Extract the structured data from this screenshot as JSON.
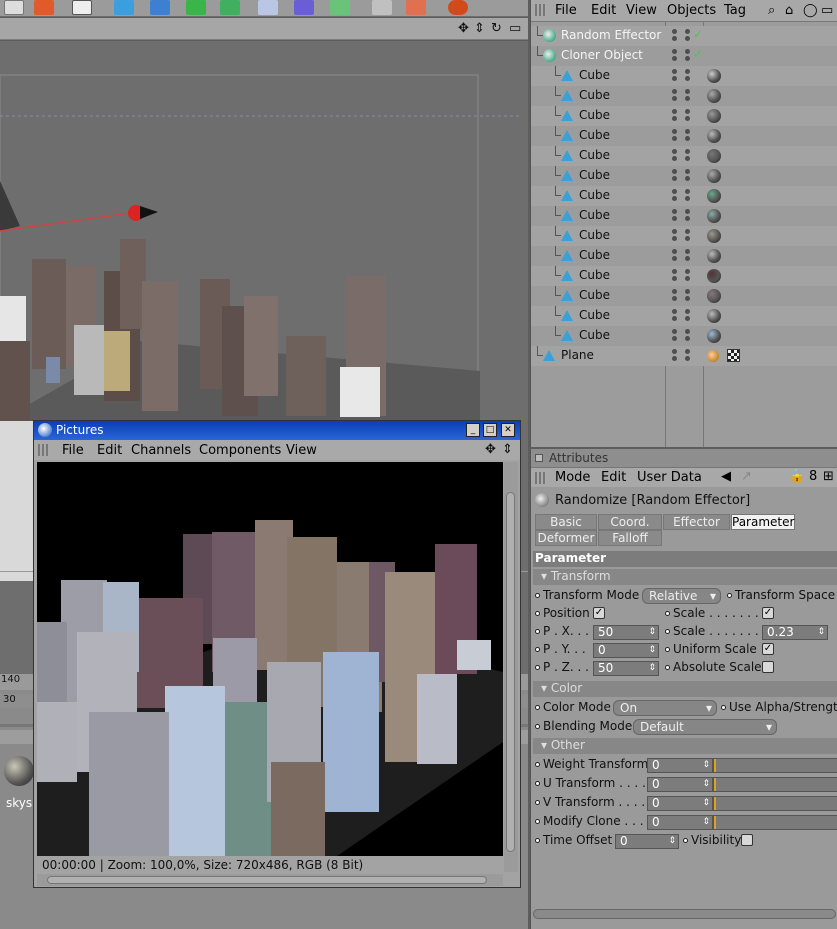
{
  "obj_menu": {
    "file": "File",
    "edit": "Edit",
    "view": "View",
    "objects": "Objects",
    "tag": "Tag"
  },
  "objects": [
    {
      "name": "Random Effector",
      "level": 0,
      "icon": "effector-icon"
    },
    {
      "name": "Cloner Object",
      "level": 0,
      "icon": "cloner-icon"
    },
    {
      "name": "Cube",
      "level": 1,
      "icon": "cube-icon"
    },
    {
      "name": "Cube",
      "level": 1,
      "icon": "cube-icon"
    },
    {
      "name": "Cube",
      "level": 1,
      "icon": "cube-icon"
    },
    {
      "name": "Cube",
      "level": 1,
      "icon": "cube-icon"
    },
    {
      "name": "Cube",
      "level": 1,
      "icon": "cube-icon"
    },
    {
      "name": "Cube",
      "level": 1,
      "icon": "cube-icon"
    },
    {
      "name": "Cube",
      "level": 1,
      "icon": "cube-icon"
    },
    {
      "name": "Cube",
      "level": 1,
      "icon": "cube-icon"
    },
    {
      "name": "Cube",
      "level": 1,
      "icon": "cube-icon"
    },
    {
      "name": "Cube",
      "level": 1,
      "icon": "cube-icon"
    },
    {
      "name": "Cube",
      "level": 1,
      "icon": "cube-icon"
    },
    {
      "name": "Cube",
      "level": 1,
      "icon": "cube-icon"
    },
    {
      "name": "Cube",
      "level": 1,
      "icon": "cube-icon"
    },
    {
      "name": "Cube",
      "level": 1,
      "icon": "cube-icon"
    },
    {
      "name": "Plane",
      "level": 0,
      "icon": "plane-icon"
    }
  ],
  "attributes": {
    "header": "Attributes",
    "menu": {
      "mode": "Mode",
      "edit": "Edit",
      "user_data": "User Data"
    },
    "object_title": "Randomize [Random Effector]",
    "tabs": [
      "Basic",
      "Coord.",
      "Effector",
      "Parameter",
      "Deformer",
      "Falloff"
    ],
    "active_tab": "Parameter",
    "section_title": "Parameter",
    "transform": {
      "label": "Transform",
      "transform_mode_label": "Transform Mode",
      "transform_mode_value": "Relative",
      "transform_space_label": "Transform Space",
      "position_label": "Position",
      "position_checked": true,
      "px_label": "P . X. . .",
      "px_value": "50",
      "py_label": "P . Y. . .",
      "py_value": "0",
      "pz_label": "P . Z. . .",
      "pz_value": "50",
      "scale_label": "Scale . . . . . . . . .",
      "scale_checked": true,
      "scale2_label": "Scale . . . . . . . . .",
      "scale_value": "0.23",
      "uniform_scale_label": "Uniform Scale",
      "uniform_checked": true,
      "absolute_scale_label": "Absolute Scale",
      "absolute_checked": false
    },
    "color": {
      "label": "Color",
      "color_mode_label": "Color Mode",
      "color_mode_value": "On",
      "use_alpha_label": "Use Alpha/Strength",
      "blending_mode_label": "Blending Mode",
      "blending_mode_value": "Default"
    },
    "other": {
      "label": "Other",
      "weight_label": "Weight Transform",
      "weight_value": "0",
      "u_label": "U Transform . . . . .",
      "u_value": "0",
      "v_label": "V Transform . . . . .",
      "v_value": "0",
      "modify_label": "Modify Clone . . . .",
      "modify_value": "0",
      "time_label": "Time Offset",
      "time_value": "0",
      "visibility_label": "Visibility"
    }
  },
  "pictures": {
    "title": "Pictures",
    "menu": [
      "File",
      "Edit",
      "Channels",
      "Components",
      "View"
    ],
    "status": "00:00:00 | Zoom: 100,0%, Size: 720x486, RGB (8 Bit)"
  },
  "viewport": {
    "frame_label": "140",
    "frame_label2": "30",
    "material_label": "skys"
  },
  "colors": {
    "title_blue": "#0a3fb5",
    "check_green": "#3ecf3e",
    "cube_icon": "#3aa0d8"
  }
}
